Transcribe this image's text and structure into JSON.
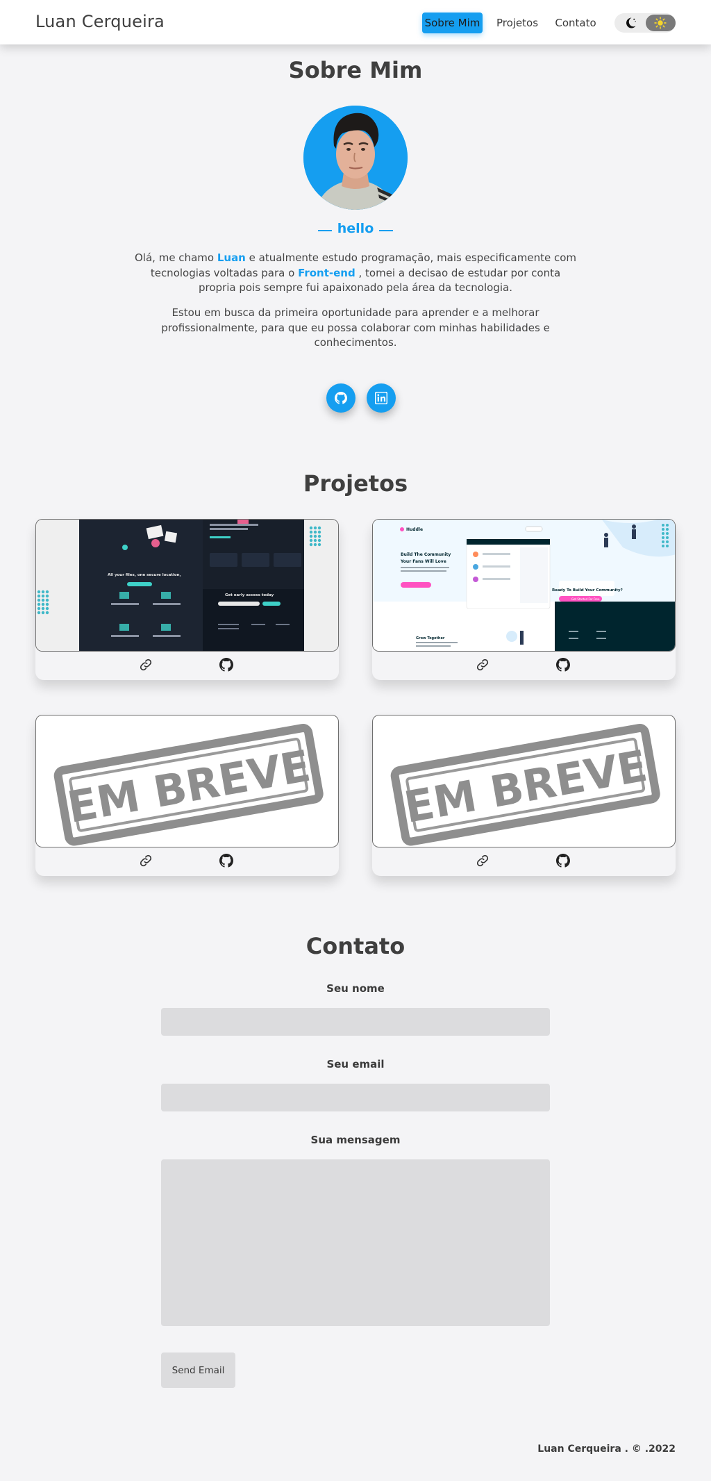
{
  "header": {
    "brand": "Luan Cerqueira",
    "nav": [
      {
        "label": "Sobre Mim",
        "active": true
      },
      {
        "label": "Projetos",
        "active": false
      },
      {
        "label": "Contato",
        "active": false
      }
    ],
    "theme_toggle": {
      "left_icon": "moon-icon",
      "right_icon": "sun-icon",
      "selected": "light"
    }
  },
  "about": {
    "title": "Sobre Mim",
    "greeting": "hello",
    "p1": {
      "before_name": "Olá, me chamo ",
      "name": "Luan",
      "after_name": " e atualmente estudo programação, mais especificamente com tecnologias voltadas para o ",
      "focus": "Front-end",
      "after_focus": " , tomei a decisao de estudar por conta propria pois sempre fui apaixonado pela área da tecnologia."
    },
    "p2": "Estou em busca da primeira oportunidade para aprender e a melhorar profissionalmente, para que eu possa colaborar com minhas habilidades e conhecimentos.",
    "social": [
      {
        "name": "github",
        "icon": "github-icon"
      },
      {
        "name": "linkedin",
        "icon": "linkedin-icon"
      }
    ]
  },
  "projects": {
    "title": "Projetos",
    "items": [
      {
        "kind": "screenshot-dark",
        "hero_text": "All your files in one secure location, accessible anywhere.",
        "cta_title": "Get early access today",
        "link_icon": "link-icon",
        "repo_icon": "github-icon"
      },
      {
        "kind": "screenshot-light",
        "brand": "Huddle",
        "hero_title": "Build The Community Your Fans Will Love",
        "subheading": "Grow Together",
        "cta_title": "Ready To Build Your Community?",
        "cta_button": "Get Started For Free",
        "link_icon": "link-icon",
        "repo_icon": "github-icon"
      },
      {
        "kind": "coming-soon",
        "stamp": "EM BREVE",
        "link_icon": "link-icon",
        "repo_icon": "github-icon"
      },
      {
        "kind": "coming-soon",
        "stamp": "EM BREVE",
        "link_icon": "link-icon",
        "repo_icon": "github-icon"
      }
    ]
  },
  "contact": {
    "title": "Contato",
    "name_label": "Seu nome",
    "name_value": "",
    "email_label": "Seu email",
    "email_value": "",
    "message_label": "Sua mensagem",
    "message_value": "",
    "submit": "Send Email"
  },
  "footer": {
    "text": "Luan Cerqueira . © .2022"
  },
  "colors": {
    "accent": "#159ef0",
    "background": "#f4f4f6",
    "field": "#dcdcde"
  }
}
